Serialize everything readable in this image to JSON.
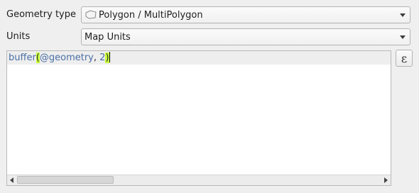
{
  "geometry_type": {
    "label": "Geometry type",
    "value": "Polygon / MultiPolygon",
    "icon": "polygon-icon"
  },
  "units": {
    "label": "Units",
    "value": "Map Units"
  },
  "expression": {
    "fn": "buffer",
    "open_paren": "(",
    "variable": "@geometry",
    "comma": ", ",
    "arg": "2",
    "close_paren": ")"
  },
  "expression_button": {
    "icon": "epsilon-icon",
    "glyph": "ε"
  }
}
